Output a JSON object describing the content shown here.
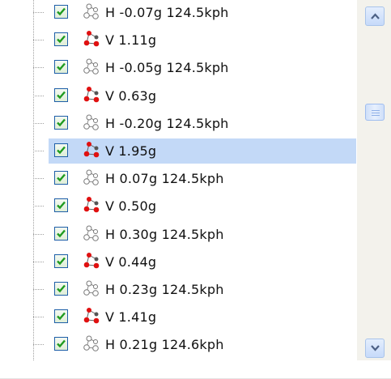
{
  "tree": {
    "rows": [
      {
        "label": "H -0.07g 124.5kph",
        "icon": "horizontal-axis-icon",
        "checked": true,
        "selected": false
      },
      {
        "label": "V 1.11g",
        "icon": "vertical-axis-icon",
        "checked": true,
        "selected": false
      },
      {
        "label": "H -0.05g 124.5kph",
        "icon": "horizontal-axis-icon",
        "checked": true,
        "selected": false
      },
      {
        "label": "V 0.63g",
        "icon": "vertical-axis-icon",
        "checked": true,
        "selected": false
      },
      {
        "label": "H -0.20g 124.5kph",
        "icon": "horizontal-axis-icon",
        "checked": true,
        "selected": false
      },
      {
        "label": "V 1.95g",
        "icon": "vertical-axis-icon",
        "checked": true,
        "selected": true
      },
      {
        "label": "H 0.07g 124.5kph",
        "icon": "horizontal-axis-icon",
        "checked": true,
        "selected": false
      },
      {
        "label": "V 0.50g",
        "icon": "vertical-axis-icon",
        "checked": true,
        "selected": false
      },
      {
        "label": "H 0.30g 124.5kph",
        "icon": "horizontal-axis-icon",
        "checked": true,
        "selected": false
      },
      {
        "label": "V 0.44g",
        "icon": "vertical-axis-icon",
        "checked": true,
        "selected": false
      },
      {
        "label": "H 0.23g 124.5kph",
        "icon": "horizontal-axis-icon",
        "checked": true,
        "selected": false
      },
      {
        "label": "V 1.41g",
        "icon": "vertical-axis-icon",
        "checked": true,
        "selected": false
      },
      {
        "label": "H 0.21g 124.6kph",
        "icon": "horizontal-axis-icon",
        "checked": true,
        "selected": false
      }
    ]
  },
  "scrollbar": {
    "up_icon": "chevron-up-icon",
    "down_icon": "chevron-down-icon",
    "position": 0.35
  },
  "colors": {
    "selection": "#c3d9f7",
    "check": "#1f9b1f",
    "vertical_icon": "#e01010"
  }
}
